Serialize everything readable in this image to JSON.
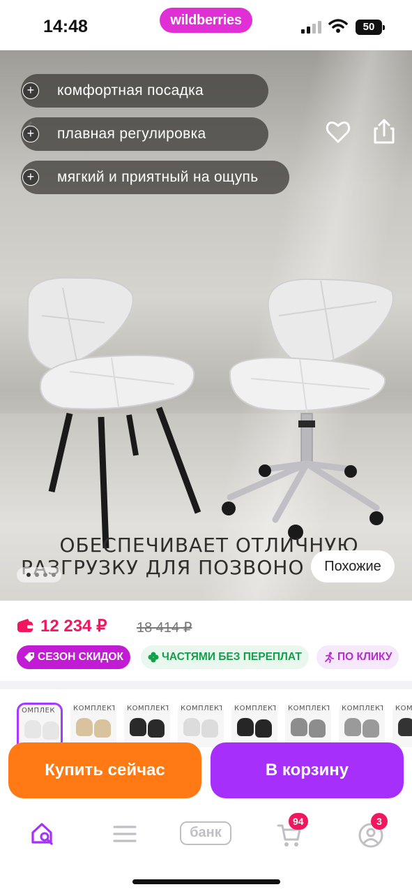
{
  "status_bar": {
    "time": "14:48",
    "brand": "wildberries",
    "battery": "50"
  },
  "hero": {
    "features": [
      {
        "label": "комфортная посадка",
        "icon": "plus-icon"
      },
      {
        "label": "плавная регулировка",
        "icon": "plus-icon"
      },
      {
        "label": "мягкий и приятный на ощупь",
        "icon": "plus-icon"
      }
    ],
    "caption_line1": "ОБЕСПЕЧИВАЕТ ОТЛИЧНУЮ",
    "caption_line2": "РАЗГРУЗКУ ДЛЯ ПОЗВОНО",
    "similar_label": "Похожие",
    "slide_dots": 4,
    "active_slide": 1
  },
  "pricing": {
    "price": "12 234 ₽",
    "old_price": "18 414 ₽",
    "price_color": "#f1175f"
  },
  "badges": [
    {
      "label": "СЕЗОН СКИДОК",
      "icon": "tag-icon",
      "bg": "#c21bd4",
      "color": "#ffffff"
    },
    {
      "label": "ЧАСТЯМИ БЕЗ ПЕРЕПЛАТ",
      "icon": "clover-icon",
      "bg": "#e9f7ee",
      "color": "#12a04a"
    },
    {
      "label": "ПО КЛИКУ",
      "icon": "runner-icon",
      "bg": "#f6e9fb",
      "color": "#b52ccf"
    }
  ],
  "thumbnails": [
    {
      "title": "ОМПЛЕК",
      "chair_color": "#e6e6e6",
      "selected": true
    },
    {
      "title": "КОМПЛЕКТ",
      "chair_color": "#d9c29e",
      "selected": false
    },
    {
      "title": "КОМПЛЕКТ",
      "chair_color": "#2a2a2a",
      "selected": false
    },
    {
      "title": "КОМПЛЕКТ",
      "chair_color": "#dcdcdc",
      "selected": false
    },
    {
      "title": "КОМПЛЕКТ",
      "chair_color": "#262626",
      "selected": false
    },
    {
      "title": "КОМПЛЕКТ",
      "chair_color": "#8d8d8d",
      "selected": false
    },
    {
      "title": "КОМПЛЕКТ",
      "chair_color": "#9a9a9a",
      "selected": false
    },
    {
      "title": "КОМ",
      "chair_color": "#333333",
      "selected": false
    }
  ],
  "actions": {
    "buy_now": "Купить сейчас",
    "add_to_cart": "В корзину",
    "buy_color": "#ff7a14",
    "cart_color": "#a62ffc"
  },
  "nav": {
    "items": [
      {
        "icon": "home-search-icon",
        "active": true
      },
      {
        "icon": "menu-icon",
        "active": false
      },
      {
        "icon": "bank-icon",
        "label": "банк",
        "active": false
      },
      {
        "icon": "cart-icon",
        "count": "94",
        "active": false
      },
      {
        "icon": "profile-icon",
        "count": "3",
        "active": false
      }
    ],
    "active_color": "#a62ffc",
    "inactive_color": "#bfbfc6"
  }
}
